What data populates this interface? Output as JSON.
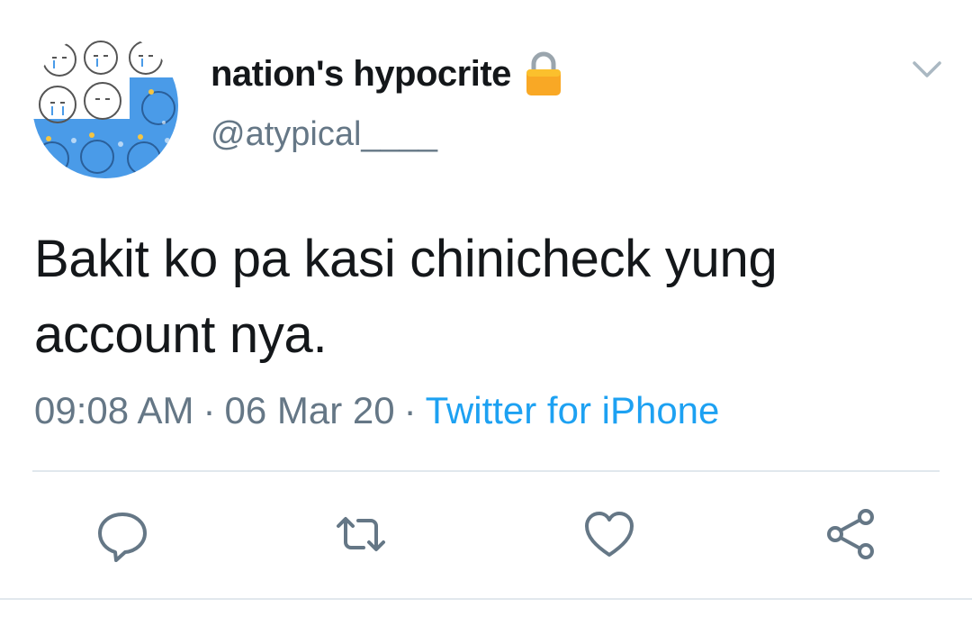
{
  "tweet": {
    "display_name": "nation's hypocrite",
    "handle": "@atypical____",
    "text": "Bakit ko pa kasi chinicheck yung account nya.",
    "time": "09:08 AM",
    "separator": "·",
    "date": "06 Mar 20",
    "source": "Twitter for iPhone"
  },
  "icons": {
    "lock": "lock-icon",
    "menu": "chevron-down-icon",
    "reply": "reply-icon",
    "retweet": "retweet-icon",
    "like": "heart-icon",
    "share": "share-icon"
  },
  "colors": {
    "text": "#14171a",
    "secondary": "#657786",
    "link": "#1da1f2",
    "divider": "#e1e8ed",
    "avatar_blue": "#4a9be8"
  }
}
